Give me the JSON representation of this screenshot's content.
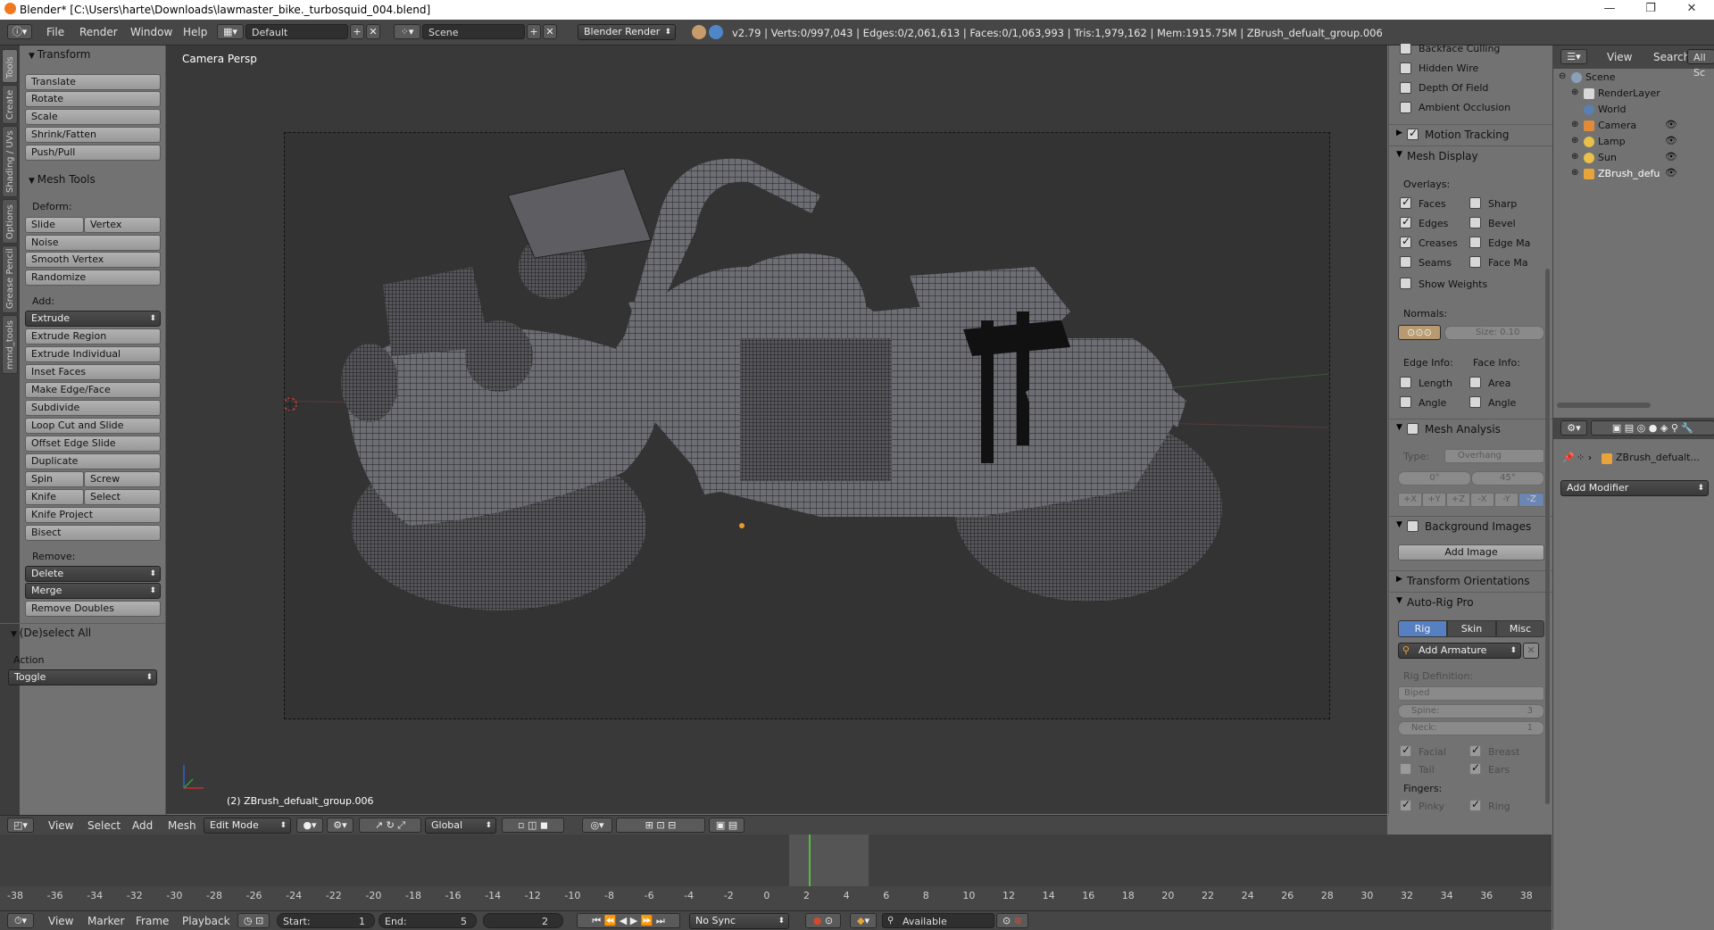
{
  "window": {
    "title": "Blender* [C:\\Users\\harte\\Downloads\\lawmaster_bike._turbosquid_004.blend]",
    "minimize": "—",
    "maximize": "❐",
    "close": "✕"
  },
  "infobar": {
    "menus": [
      "File",
      "Render",
      "Window",
      "Help"
    ],
    "layout": "Default",
    "scene": "Scene",
    "engine": "Blender Render",
    "stats": "v2.79 | Verts:0/997,043 | Edges:0/2,061,613 | Faces:0/1,063,993 | Tris:1,979,162 | Mem:1915.75M | ZBrush_defualt_group.006"
  },
  "tool_tabs": [
    "Tools",
    "Create",
    "Shading / UVs",
    "Options",
    "Grease Pencil",
    "mmd_tools"
  ],
  "toolshelf": {
    "transform": {
      "title": "Transform",
      "buttons": [
        "Translate",
        "Rotate",
        "Scale",
        "Shrink/Fatten",
        "Push/Pull"
      ]
    },
    "mesh_tools": {
      "title": "Mesh Tools",
      "deform_label": "Deform:",
      "slide_edge": "Slide Edge",
      "vertex": "Vertex",
      "noise": "Noise",
      "smooth_vertex": "Smooth Vertex",
      "randomize": "Randomize",
      "add_label": "Add:",
      "extrude": "Extrude",
      "extrude_region": "Extrude Region",
      "extrude_individual": "Extrude Individual",
      "inset_faces": "Inset Faces",
      "make_edge_face": "Make Edge/Face",
      "subdivide": "Subdivide",
      "loop_cut": "Loop Cut and Slide",
      "offset_edge": "Offset Edge Slide",
      "duplicate": "Duplicate",
      "spin": "Spin",
      "screw": "Screw",
      "knife": "Knife",
      "select": "Select",
      "knife_project": "Knife Project",
      "bisect": "Bisect",
      "remove_label": "Remove:",
      "delete": "Delete",
      "merge": "Merge",
      "remove_doubles": "Remove Doubles"
    },
    "deselect": {
      "title": "(De)select All",
      "action_label": "Action",
      "action_value": "Toggle"
    }
  },
  "viewport": {
    "view_label": "Camera Persp",
    "object_label": "(2) ZBrush_defualt_group.006"
  },
  "viewport_header": {
    "menus": [
      "View",
      "Select",
      "Add",
      "Mesh"
    ],
    "mode": "Edit Mode",
    "orientation": "Global"
  },
  "npanel": {
    "top_checks": [
      "Backface Culling",
      "Hidden Wire",
      "Depth Of Field",
      "Ambient Occlusion"
    ],
    "motion_tracking": "Motion Tracking",
    "mesh_display": {
      "title": "Mesh Display",
      "overlays_label": "Overlays:",
      "faces": "Faces",
      "sharp": "Sharp",
      "edges": "Edges",
      "bevel": "Bevel",
      "creases": "Creases",
      "edge_ma": "Edge Ma",
      "seams": "Seams",
      "face_ma": "Face Ma",
      "show_weights": "Show Weights",
      "normals_label": "Normals:",
      "size": "Size:  0.10",
      "edge_info": "Edge Info:",
      "face_info": "Face Info:",
      "length": "Length",
      "area": "Area",
      "angle1": "Angle",
      "angle2": "Angle"
    },
    "mesh_analysis": {
      "title": "Mesh Analysis",
      "type_label": "Type:",
      "type_value": "Overhang",
      "min": "0°",
      "max": "45°",
      "axes": [
        "+X",
        "+Y",
        "+Z",
        "-X",
        "-Y",
        "-Z"
      ]
    },
    "background_images": "Background Images",
    "add_image": "Add Image",
    "transform_orientations": "Transform Orientations",
    "auto_rig_pro": {
      "title": "Auto-Rig Pro",
      "tabs": [
        "Rig",
        "Skin",
        "Misc"
      ],
      "add_armature": "Add Armature",
      "rig_definition": "Rig Definition:",
      "biped": "Biped",
      "spine": "Spine:",
      "spine_val": "3",
      "neck": "Neck:",
      "neck_val": "1",
      "facial": "Facial",
      "breast": "Breast",
      "tail": "Tail",
      "ears": "Ears",
      "fingers_label": "Fingers:",
      "pinky": "Pinky",
      "ring": "Ring"
    }
  },
  "outliner": {
    "view": "View",
    "search": "Search",
    "all_scenes": "All Sc",
    "rows": [
      "Scene",
      "RenderLayer",
      "World",
      "Camera",
      "Lamp",
      "Sun",
      "ZBrush_defu"
    ]
  },
  "properties": {
    "object_name": "ZBrush_defualt...",
    "add_modifier": "Add Modifier"
  },
  "timeline": {
    "ticks": [
      "-38",
      "-36",
      "-34",
      "-32",
      "-30",
      "-28",
      "-26",
      "-24",
      "-22",
      "-20",
      "-18",
      "-16",
      "-14",
      "-12",
      "-10",
      "-8",
      "-6",
      "-4",
      "-2",
      "0",
      "2",
      "4",
      "6",
      "8",
      "10",
      "12",
      "14",
      "16",
      "18",
      "20",
      "22",
      "24",
      "26",
      "28",
      "30",
      "32",
      "34",
      "36",
      "38"
    ],
    "current_frame": 2,
    "menus": [
      "View",
      "Marker",
      "Frame",
      "Playback"
    ],
    "start": "Start:",
    "start_val": "1",
    "end": "End:",
    "end_val": "5",
    "frame_val": "2",
    "sync": "No Sync",
    "keying": "Available"
  },
  "colors": {
    "accent": "#5680c2",
    "frame_marker": "#4fbf3a",
    "dark_header": "#464646"
  }
}
